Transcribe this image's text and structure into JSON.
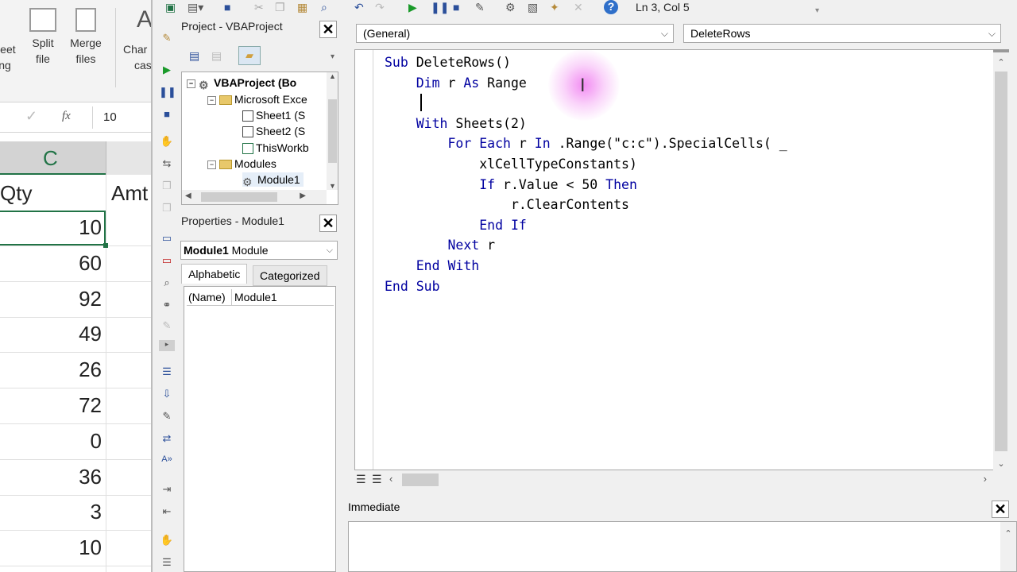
{
  "excel": {
    "ribbon": {
      "sheet_label_1": "heet",
      "sheet_label_2": "ng",
      "split_label_1": "Split",
      "split_label_2": "file",
      "merge_label_1": "Merge",
      "merge_label_2": "files",
      "change_label_1": "Char",
      "change_label_2": "cas",
      "big_letter": "A"
    },
    "formula_bar": {
      "fx": "fx",
      "value": "10"
    },
    "column_letter": "C",
    "headers": {
      "qty": "Qty",
      "amt": "Amt"
    },
    "qty_values": [
      "10",
      "60",
      "92",
      "49",
      "26",
      "72",
      "0",
      "36",
      "3",
      "10"
    ]
  },
  "vbe": {
    "toolbar": {
      "status": "Ln 3, Col 5"
    },
    "project_panel": {
      "title": "Project - VBAProject",
      "nodes": [
        {
          "label": "VBAProject (Bo",
          "bold": true
        },
        {
          "label": "Microsoft Exce"
        },
        {
          "label": "Sheet1 (S"
        },
        {
          "label": "Sheet2 (S"
        },
        {
          "label": "ThisWorkb"
        },
        {
          "label": "Modules"
        },
        {
          "label": "Module1"
        }
      ]
    },
    "properties_panel": {
      "title": "Properties - Module1",
      "object_name": "Module1",
      "object_type": "Module",
      "tabs": [
        "Alphabetic",
        "Categorized"
      ],
      "grid_name_label": "(Name)",
      "grid_name_value": "Module1"
    },
    "code_window": {
      "object_combo": "(General)",
      "proc_combo": "DeleteRows",
      "lines": [
        "Sub DeleteRows()",
        "    Dim r As Range",
        "    ",
        "    With Sheets(2)",
        "        For Each r In .Range(\"c:c\").SpecialCells( _",
        "            xlCellTypeConstants)",
        "            If r.Value < 50 Then",
        "                r.ClearContents",
        "            End If",
        "        Next r",
        "    End With",
        "End Sub"
      ]
    },
    "immediate": {
      "title": "Immediate"
    }
  },
  "colors": {
    "keyword": "#0000a0",
    "highlight": "#f078f0",
    "excel_green": "#217346"
  }
}
